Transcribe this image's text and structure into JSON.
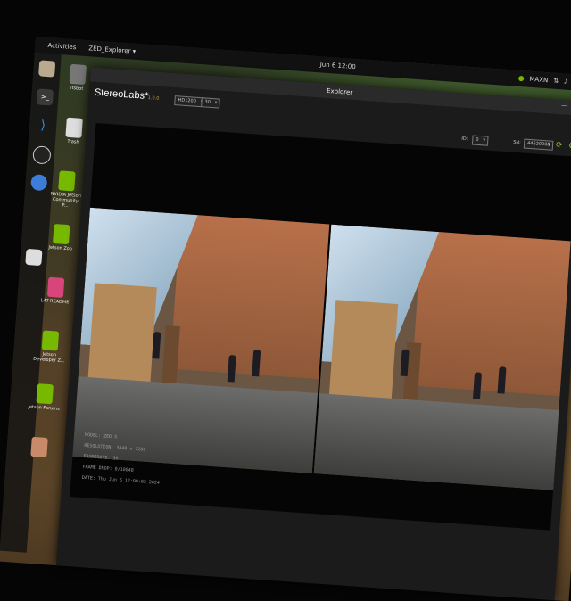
{
  "topbar": {
    "activities": "Activities",
    "app_menu": "ZED_Explorer ▾",
    "clock": "Jun 6  12:00",
    "power_mode": "MAXN"
  },
  "dock": [
    "files-icon",
    "terminal-icon",
    "vscode-icon",
    "obs-icon",
    "chromium-icon",
    "text-editor-icon"
  ],
  "desktop_items": [
    {
      "label": "itsbot",
      "icon": "folder-icon"
    },
    {
      "label": "Trash",
      "icon": "trash-icon"
    },
    {
      "label": "NVIDIA Jetson Community P...",
      "icon": "nvidia-icon"
    },
    {
      "label": "Jetson Zoo",
      "icon": "nvidia-icon"
    },
    {
      "label": "L4T-README",
      "icon": "drive-icon"
    },
    {
      "label": "Jetson Developer Z...",
      "icon": "nvidia-icon"
    },
    {
      "label": "Jetson Forums",
      "icon": "nvidia-icon"
    },
    {
      "label": "",
      "icon": "document-icon"
    }
  ],
  "window": {
    "title": "Explorer",
    "brand": "StereoLabs*",
    "brand_version": "1.0.0",
    "resolution_select": "HD1200",
    "fps_select": "30",
    "camera_label": "ID:",
    "camera_select": "0",
    "serial_label": "SN:",
    "serial_value": "44620008"
  },
  "meta_lines": [
    "MODEL: ZED X",
    "RESOLUTION: 3840 x 1200",
    "FRAMERATE: 30",
    "FRAME DROP: 0/10048",
    "DATE: Thu Jun 6 12:00:03 2024"
  ]
}
